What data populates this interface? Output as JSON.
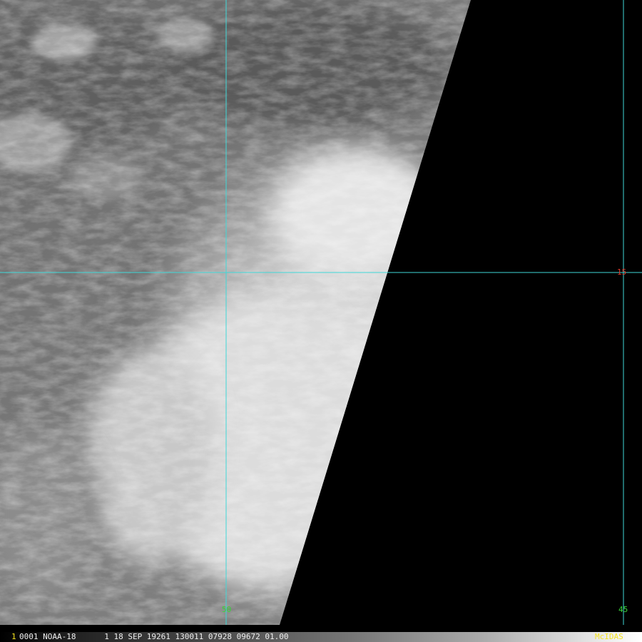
{
  "overlay": {
    "lon_labels": [
      "50",
      "45"
    ],
    "lat_labels": [
      "15"
    ],
    "grid_color": "#3fd8d8",
    "lon_label_color": "#39d639",
    "lat_label_color": "#e23a2a"
  },
  "status_bar": {
    "frame_number": "1",
    "text": "0001 NOAA-18      1 18 SEP 19261 130011 07928 09672 01.00",
    "brand": "McIDAS",
    "brand_color": "#f4e21e"
  },
  "imagery": {
    "kind": "grayscale satellite cloud imagery",
    "swath_edge_color": "#000000"
  }
}
